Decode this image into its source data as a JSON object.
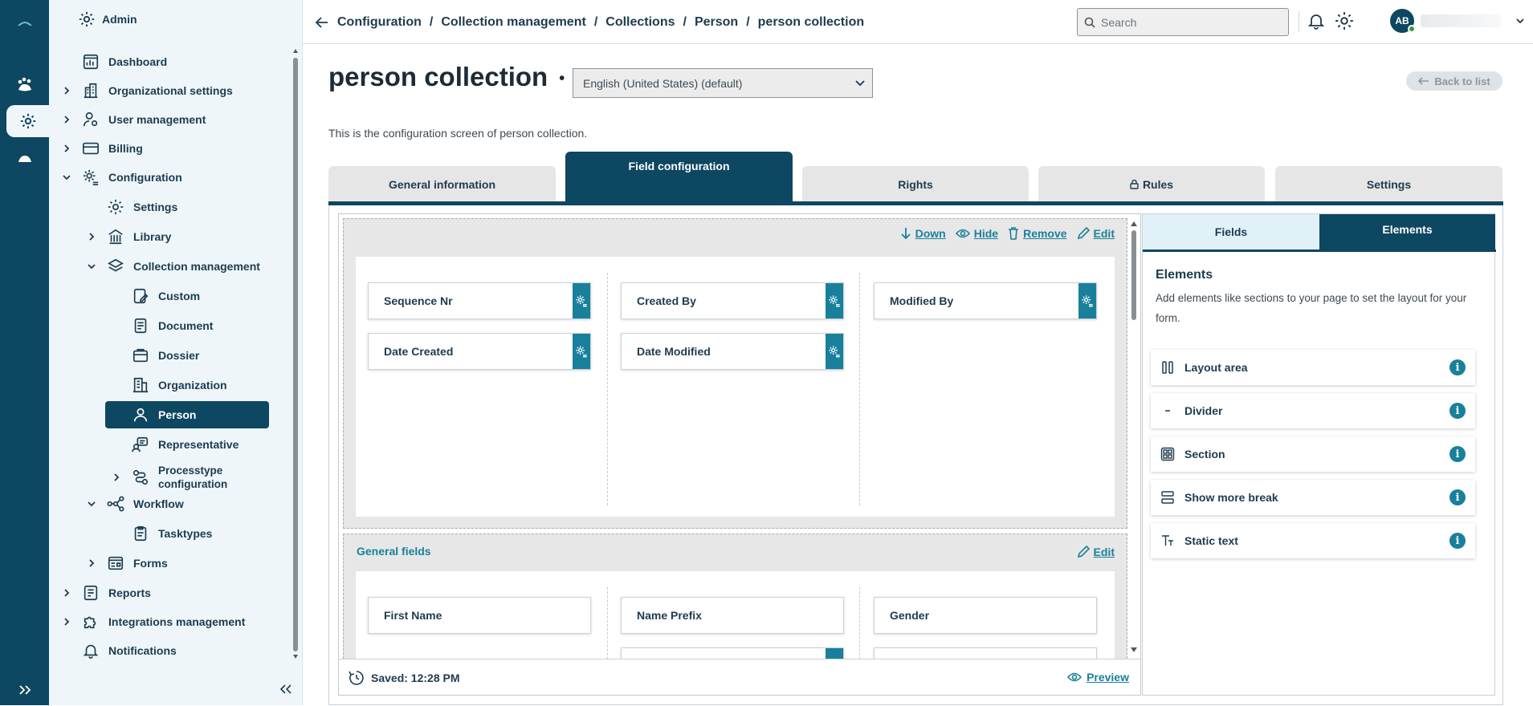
{
  "topbar": {
    "breadcrumb": [
      "Configuration",
      "Collection management",
      "Collections",
      "Person",
      "person collection"
    ],
    "breadcrumb_sep": "/",
    "search_placeholder": "Search",
    "avatar_initials": "AB"
  },
  "sidebar": {
    "header": "Admin",
    "items": [
      {
        "label": "Dashboard",
        "icon": "dashboard-icon"
      },
      {
        "label": "Organizational settings",
        "icon": "building-icon"
      },
      {
        "label": "User management",
        "icon": "user-gear-icon"
      },
      {
        "label": "Billing",
        "icon": "credit-card-icon"
      },
      {
        "label": "Configuration",
        "icon": "gear-list-icon"
      },
      {
        "label": "Settings",
        "icon": "gear-icon"
      },
      {
        "label": "Library",
        "icon": "library-icon"
      },
      {
        "label": "Collection management",
        "icon": "layers-icon"
      },
      {
        "label": "Custom",
        "icon": "custom-doc-icon"
      },
      {
        "label": "Document",
        "icon": "document-icon"
      },
      {
        "label": "Dossier",
        "icon": "dossier-icon"
      },
      {
        "label": "Organization",
        "icon": "organization-icon"
      },
      {
        "label": "Person",
        "icon": "person-icon"
      },
      {
        "label": "Representative",
        "icon": "representative-icon"
      },
      {
        "label": "Processtype",
        "label2": "configuration",
        "icon": "processtype-icon"
      },
      {
        "label": "Workflow",
        "icon": "workflow-icon"
      },
      {
        "label": "Tasktypes",
        "icon": "clipboard-icon"
      },
      {
        "label": "Forms",
        "icon": "forms-icon"
      },
      {
        "label": "Reports",
        "icon": "reports-icon"
      },
      {
        "label": "Integrations management",
        "icon": "puzzle-icon"
      },
      {
        "label": "Notifications",
        "icon": "bell-icon"
      }
    ]
  },
  "page": {
    "title": "person collection",
    "language": "English (United States) (default)",
    "back_label": "Back to list",
    "description": "This is the configuration screen of person collection.",
    "tabs": [
      "General information",
      "Field configuration",
      "Rights",
      "Rules",
      "Settings"
    ],
    "active_tab": "Field configuration"
  },
  "editor": {
    "section1_actions": [
      "Down",
      "Hide",
      "Remove",
      "Edit"
    ],
    "section1_fields": [
      "Sequence Nr",
      "Created By",
      "Modified By",
      "Date Created",
      "Date Modified"
    ],
    "section2_title": "General fields",
    "section2_edit": "Edit",
    "section2_fields": [
      "First Name",
      "Name Prefix",
      "Gender"
    ],
    "saved_label": "Saved: 12:28 PM",
    "preview_label": "Preview"
  },
  "panel": {
    "tabs": [
      "Fields",
      "Elements"
    ],
    "active_tab": "Elements",
    "title": "Elements",
    "description": "Add elements like sections to your page to set the layout for your form.",
    "elements": [
      {
        "label": "Layout area",
        "icon": "columns-icon"
      },
      {
        "label": "Divider",
        "icon": "divider-icon"
      },
      {
        "label": "Section",
        "icon": "section-icon"
      },
      {
        "label": "Show more break",
        "icon": "stack-icon"
      },
      {
        "label": "Static text",
        "icon": "text-icon"
      }
    ],
    "info_glyph": "i"
  },
  "colors": {
    "brand": "#0d4761",
    "accent": "#19809c",
    "nav_bg": "#eef6fa"
  }
}
